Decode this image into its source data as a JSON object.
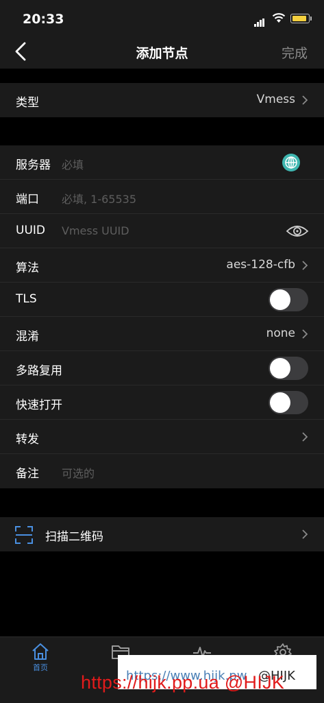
{
  "status": {
    "time": "20:33"
  },
  "nav": {
    "title": "添加节点",
    "done": "完成",
    "back_icon": "chevron-left-icon"
  },
  "type_row": {
    "label": "类型",
    "value": "Vmess"
  },
  "fields": {
    "server": {
      "label": "服务器",
      "placeholder": "必填"
    },
    "port": {
      "label": "端口",
      "placeholder": "必填, 1-65535"
    },
    "uuid": {
      "label": "UUID",
      "placeholder": "Vmess UUID"
    },
    "algorithm": {
      "label": "算法",
      "value": "aes-128-cfb"
    },
    "tls": {
      "label": "TLS",
      "on": false
    },
    "obfs": {
      "label": "混淆",
      "value": "none"
    },
    "mux": {
      "label": "多路复用",
      "on": false
    },
    "fast_open": {
      "label": "快速打开",
      "on": false
    },
    "forward": {
      "label": "转发"
    },
    "remark": {
      "label": "备注",
      "placeholder": "可选的"
    }
  },
  "scan": {
    "label": "扫描二维码"
  },
  "tabbar": {
    "home_label": "首页"
  },
  "watermark": {
    "blue": "https://www.hijk.pw",
    "dark": "@HIJK",
    "red": "https://hijk.pp.ua @HIJK"
  },
  "colors": {
    "accent": "#4a90e2",
    "globe": "#3fb6b0",
    "bg": "#000000",
    "cell": "#1b1b1b"
  }
}
